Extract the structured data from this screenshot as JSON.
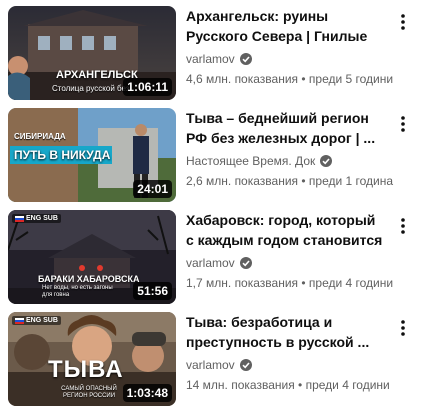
{
  "videos": [
    {
      "title": "Архангельск: руины Русского Севера | Гнилые бараки и ...",
      "channel": "varlamov",
      "verified": true,
      "stats": "4,6 млн. показвания • преди 5 години",
      "duration": "1:06:11",
      "thumb_title": "АРХАНГЕЛЬСК",
      "thumb_sub": "Столица русской без",
      "thumb_badge": ""
    },
    {
      "title": "Тыва – беднейший регион РФ без железных дорог | ...",
      "channel": "Настоящее Время. Док",
      "verified": true,
      "stats": "2,6 млн. показвания • преди 1 година",
      "duration": "24:01",
      "thumb_title": "ПУТЬ В НИКУДА",
      "thumb_sub": "СИБИРИАДА",
      "thumb_badge": ""
    },
    {
      "title": "Хабаровск: город, который с каждым годом становится ...",
      "channel": "varlamov",
      "verified": true,
      "stats": "1,7 млн. показвания • преди 4 години",
      "duration": "51:56",
      "thumb_title": "БАРАКИ ХАБАРОВСКА",
      "thumb_sub": "Нет воды, но есть загоны для говна",
      "thumb_badge": "ENG SUB"
    },
    {
      "title": "Тыва: безработица и преступность в русской ...",
      "channel": "varlamov",
      "verified": true,
      "stats": "14 млн. показвания • преди 4 години",
      "duration": "1:03:48",
      "thumb_title": "ТЫВА",
      "thumb_sub": "САМЫЙ ОПАСНЫЙ РЕГИОН РОССИИ",
      "thumb_badge": "ENG SUB"
    }
  ]
}
